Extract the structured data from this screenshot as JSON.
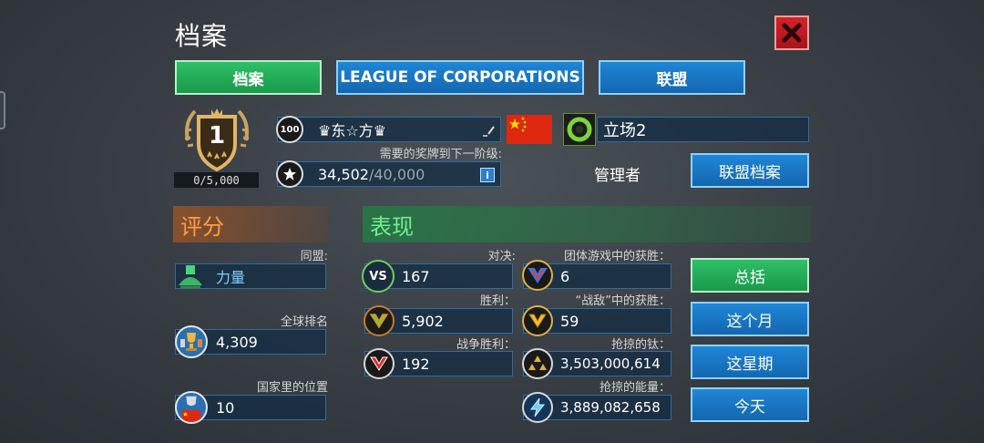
{
  "window": {
    "title": "档案"
  },
  "tabs": [
    {
      "label": "档案",
      "active": true
    },
    {
      "label": "LEAGUE OF CORPORATIONS",
      "active": false
    },
    {
      "label": "联盟",
      "active": false
    }
  ],
  "player": {
    "rank": "1",
    "rank_progress": "0/5,000",
    "level": "100",
    "name": "♛东☆方♛",
    "medals_hint": "需要的奖牌到下一阶级:",
    "medals_current": "34,502",
    "medals_target": "/40,000",
    "alliance_name": "立场2",
    "role": "管理者",
    "alliance_profile_label": "联盟档案"
  },
  "rating": {
    "header": "评分",
    "alliance_label": "同盟:",
    "alliance_value": "力量",
    "global_rank_label": "全球排名",
    "global_rank_value": "4,309",
    "country_rank_label": "国家里的位置",
    "country_rank_value": "10"
  },
  "performance": {
    "header": "表现",
    "battles_label": "对决:",
    "battles_value": "167",
    "team_wins_label": "团体游戏中的获胜：",
    "team_wins_value": "6",
    "victories_label": "胜利：",
    "victories_value": "5,902",
    "enemy_wins_label": "“战敌”中的获胜：",
    "enemy_wins_value": "59",
    "war_wins_label": "战争胜利：",
    "war_wins_value": "192",
    "titanium_label": "抢掠的钛：",
    "titanium_value": "3,503,000,614",
    "energy_label": "抢掠的能量：",
    "energy_value": "3,889,082,658"
  },
  "period_buttons": {
    "total": "总括",
    "month": "这个月",
    "week": "这星期",
    "today": "今天"
  }
}
